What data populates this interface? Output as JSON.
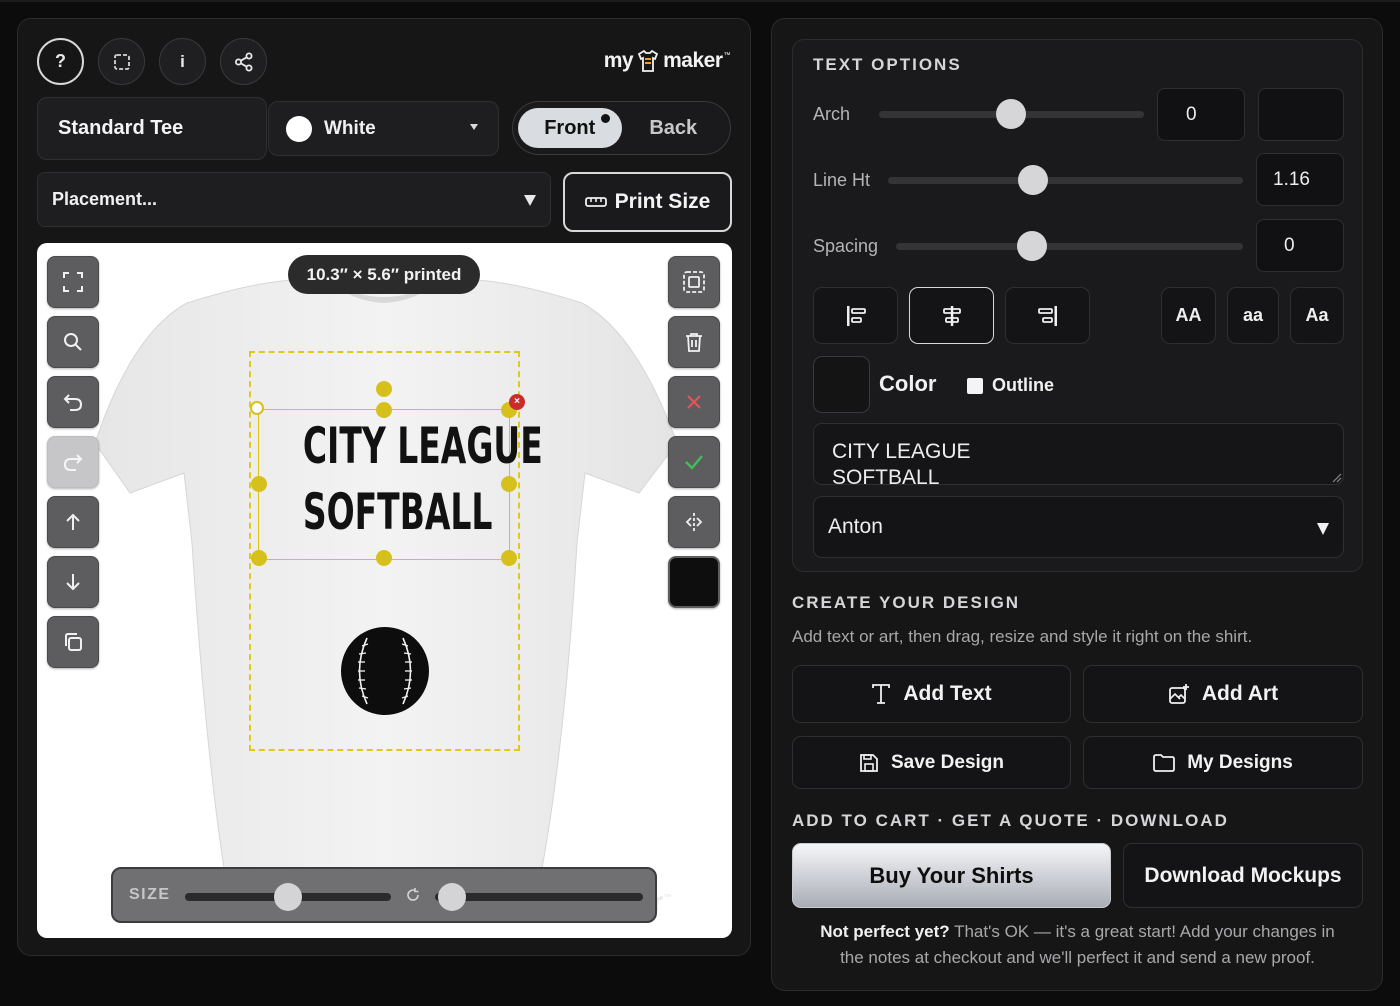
{
  "header": {
    "help_label": "?",
    "info_label": "i",
    "logo_left": "my",
    "logo_right": "maker",
    "logo_tm": "™"
  },
  "product": {
    "name": "Standard Tee",
    "color_name": "White",
    "color_hex": "#ffffff",
    "side_front": "Front",
    "side_back": "Back",
    "active_side": "Front"
  },
  "placement": {
    "label": "Placement...",
    "print_size_label": "Print Size"
  },
  "canvas": {
    "print_dimensions": "10.3″ × 5.6″ printed",
    "design_text": "CITY LEAGUE\nSOFTBALL",
    "text_color": "#121212",
    "guide_color": "#e0c91a",
    "size_label": "SIZE",
    "size_value": 0.5,
    "rotate_value": 0.08,
    "watermark_left": "my",
    "watermark_right": "aker",
    "watermark_tm": "™"
  },
  "text_options": {
    "title": "TEXT OPTIONS",
    "arch_label": "Arch",
    "arch_value": "0",
    "line_height_label": "Line Ht",
    "line_height_value": "1.16",
    "spacing_label": "Spacing",
    "spacing_value": "0",
    "case_upper": "AA",
    "case_lower": "aa",
    "case_title": "Aa",
    "color_label": "Color",
    "color_hex": "#141414",
    "outline_label": "Outline",
    "text_value": "CITY LEAGUE\nSOFTBALL",
    "font_name": "Anton",
    "alignment": "center"
  },
  "create": {
    "title": "CREATE YOUR DESIGN",
    "description": "Add text or art, then drag, resize and style it right on the shirt.",
    "add_text": "Add Text",
    "add_art": "Add Art",
    "save_design": "Save Design",
    "my_designs": "My Designs"
  },
  "cart": {
    "title": "ADD TO CART · GET A QUOTE · DOWNLOAD",
    "buy_label": "Buy Your Shirts",
    "download_label": "Download Mockups",
    "note_bold": "Not perfect yet?",
    "note_line1": "That's OK — it's a great start! Add your changes in",
    "note_line2": "the notes at checkout and we'll perfect it and send a new proof."
  }
}
